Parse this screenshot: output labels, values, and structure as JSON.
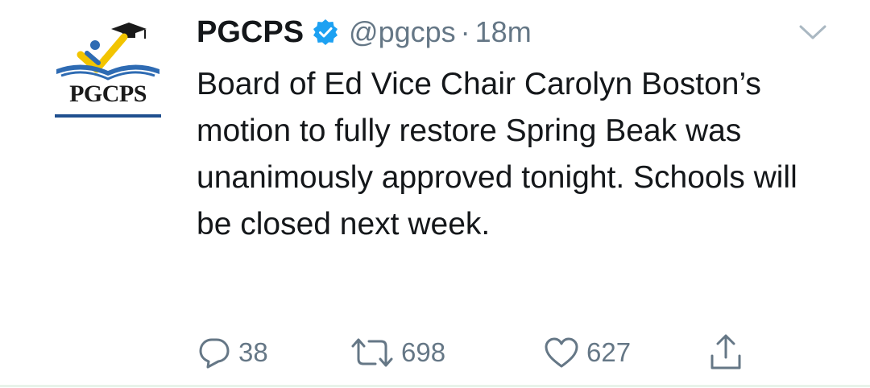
{
  "tweet": {
    "display_name": "PGCPS",
    "handle": "@pgcps",
    "separator": "·",
    "time": "18m",
    "verified": true,
    "avatar": {
      "logo_text": "PGCPS",
      "colors": {
        "book": "#2e6bb3",
        "check": "#f2c400",
        "figure": "#2e6bb3",
        "cap": "#1a1a1a"
      }
    },
    "text": "Board of Ed Vice Chair Carolyn Boston’s motion to fully restore Spring Beak was unanimously approved tonight. Schools will be closed next week.",
    "actions": {
      "reply_count": "38",
      "retweet_count": "698",
      "like_count": "627"
    }
  },
  "colors": {
    "text_primary": "#14171a",
    "text_secondary": "#657786",
    "verified_badge": "#1da1f2"
  }
}
